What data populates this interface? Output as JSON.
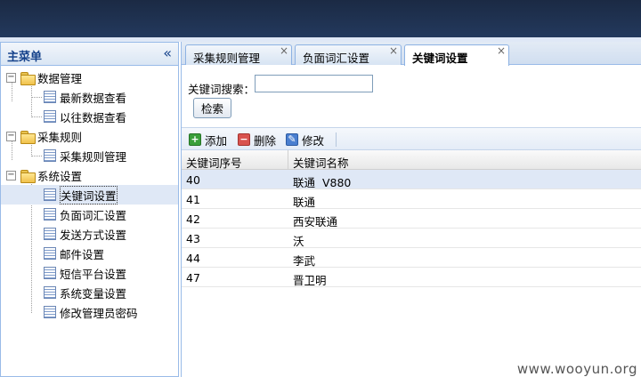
{
  "sidebar": {
    "title": "主菜单",
    "collapse_glyph": "«",
    "groups": [
      {
        "label": "数据管理",
        "items": [
          "最新数据查看",
          "以往数据查看"
        ]
      },
      {
        "label": "采集规则",
        "items": [
          "采集规则管理"
        ]
      },
      {
        "label": "系统设置",
        "items": [
          "关键词设置",
          "负面词汇设置",
          "发送方式设置",
          "邮件设置",
          "短信平台设置",
          "系统变量设置",
          "修改管理员密码"
        ]
      }
    ],
    "selected_item": "关键词设置"
  },
  "tabs": [
    {
      "label": "采集规则管理",
      "active": false
    },
    {
      "label": "负面词汇设置",
      "active": false
    },
    {
      "label": "关键词设置",
      "active": true
    }
  ],
  "search": {
    "label": "关键词搜索：",
    "value": "",
    "button_label": "检索"
  },
  "toolbar": {
    "add_label": "添加",
    "delete_label": "删除",
    "edit_label": "修改"
  },
  "grid": {
    "columns": [
      "关键词序号",
      "关键词名称"
    ],
    "rows": [
      {
        "id": "40",
        "name": "联通  V880"
      },
      {
        "id": "41",
        "name": "联通"
      },
      {
        "id": "42",
        "name": "西安联通"
      },
      {
        "id": "43",
        "name": "沃"
      },
      {
        "id": "44",
        "name": "李武"
      },
      {
        "id": "47",
        "name": "晋卫明"
      }
    ]
  },
  "watermark": "www.wooyun.org",
  "colors": {
    "banner": "#1b2a44",
    "panel_border": "#99bbe8",
    "selection": "#dfe8f6",
    "header_text": "#15428b"
  }
}
